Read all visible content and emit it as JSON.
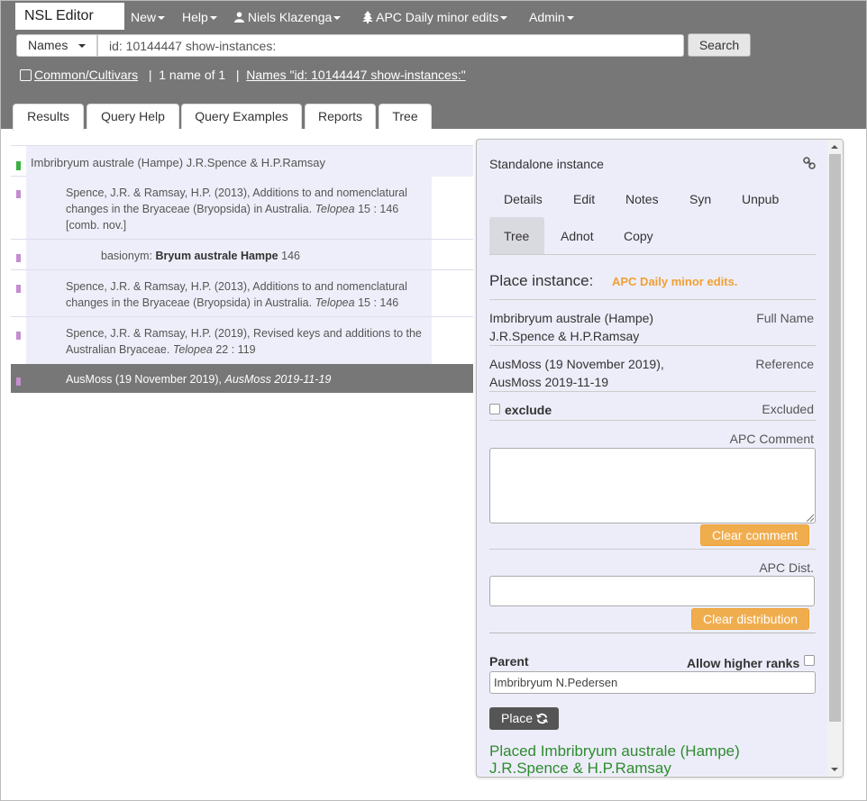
{
  "header": {
    "brand": "NSL Editor",
    "menus": [
      {
        "label": "New"
      },
      {
        "label": "Help"
      },
      {
        "label": "Niels Klazenga",
        "icon": "user-icon"
      },
      {
        "label": "APC Daily minor edits",
        "icon": "tree-icon"
      },
      {
        "label": "Admin"
      }
    ],
    "search": {
      "type_selected": "Names",
      "query": "id: 10144447 show-instances:",
      "button_label": "Search"
    },
    "info": {
      "common_cultivars": "Common/Cultivars",
      "separator": "|",
      "count": "1 name of 1",
      "names_link": "Names \"id: 10144447 show-instances:\""
    },
    "tabs": [
      "Results",
      "Query Help",
      "Query Examples",
      "Reports",
      "Tree"
    ],
    "active_tab": "Results"
  },
  "results": {
    "name_row": "Imbribryum australe (Hampe) J.R.Spence & H.P.Ramsay",
    "instances": [
      {
        "pre": "Spence, J.R. & Ramsay, H.P. (2013), Additions to and nomenclatural changes in the Bryaceae (Bryopsida) in Australia.",
        "journal": "Telopea",
        "post": "15 : 146 [comb. nov.]"
      },
      {
        "label": "basionym:",
        "name": "Bryum australe Hampe",
        "page": "146"
      },
      {
        "pre": "Spence, J.R. & Ramsay, H.P. (2013), Additions to and nomenclatural changes in the Bryaceae (Bryopsida) in Australia.",
        "journal": "Telopea",
        "post": "15 : 146"
      },
      {
        "pre": "Spence, J.R. & Ramsay, H.P. (2019), Revised keys and additions to the Australian Bryaceae.",
        "journal": "Telopea",
        "post": "22 : 119"
      },
      {
        "pre": "AusMoss (19 November 2019),",
        "journal": "AusMoss 2019-11-19",
        "post": ""
      }
    ]
  },
  "panel": {
    "title": "Standalone instance",
    "subtabs": [
      "Details",
      "Edit",
      "Notes",
      "Syn",
      "Unpub",
      "Tree",
      "Adnot",
      "Copy"
    ],
    "active_subtab": "Tree",
    "place_label": "Place instance:",
    "tree_name": "APC Daily minor edits.",
    "full_name_line1": "Imbribryum australe (Hampe)",
    "full_name_line2": "J.R.Spence & H.P.Ramsay",
    "full_name_label": "Full Name",
    "reference_line1": "AusMoss (19 November 2019),",
    "reference_line2": "AusMoss 2019-11-19",
    "reference_label": "Reference",
    "exclude_label": "exclude",
    "excluded_label": "Excluded",
    "comment_label": "APC Comment",
    "comment_value": "",
    "clear_comment": "Clear comment",
    "dist_label": "APC Dist.",
    "dist_value": "",
    "clear_distribution": "Clear distribution",
    "parent_label": "Parent",
    "allow_higher_ranks": "Allow higher ranks",
    "parent_value": "Imbribryum N.Pedersen",
    "place_button": "Place",
    "placed_message_line1": "Placed Imbribryum australe (Hampe)",
    "placed_message_line2": "J.R.Spence & H.P.Ramsay"
  },
  "colors": {
    "header_bg": "#777777",
    "accent_orange": "#f0ad4e",
    "tree_name_orange": "#f0a030",
    "placed_green": "#2e8b2e",
    "name_marker_green": "#3cb043",
    "instance_marker_purple": "#c38ed0",
    "row_bg": "#eeeefa",
    "selected_row_bg": "#777777"
  }
}
